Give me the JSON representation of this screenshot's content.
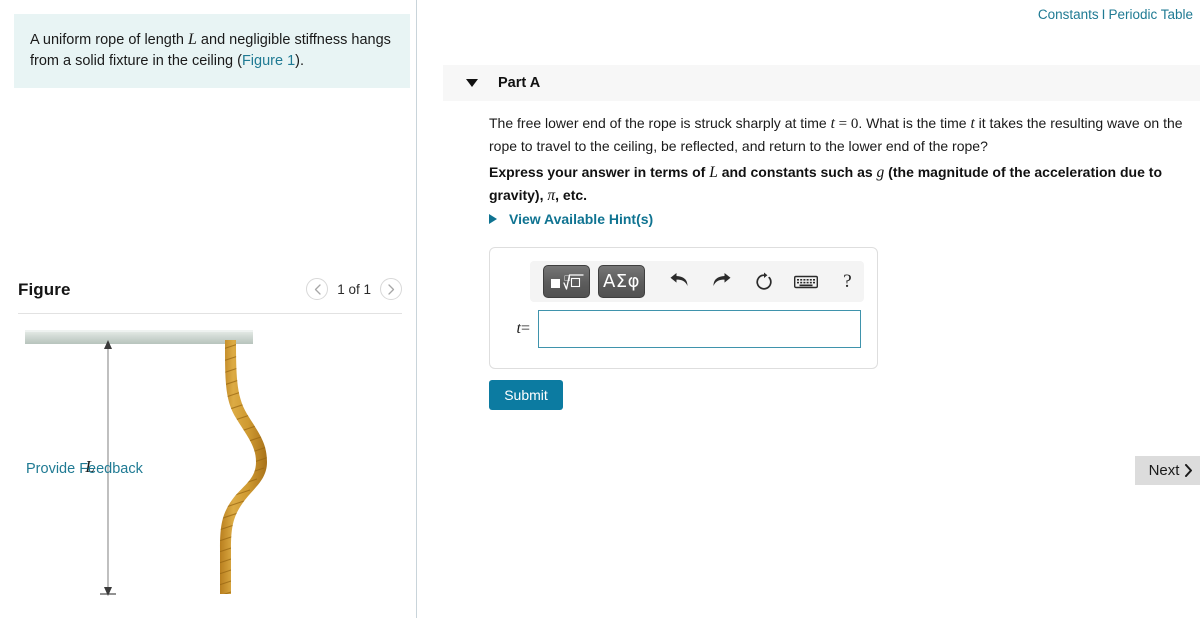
{
  "top_links": {
    "constants": "Constants",
    "separator": "I",
    "periodic_table": "Periodic Table"
  },
  "problem": {
    "text_part1": "A uniform rope of length ",
    "var_L": "L",
    "text_part2": " and negligible stiffness hangs from a solid fixture in the ceiling (",
    "figure_link": "Figure 1",
    "text_part3": ")."
  },
  "figure_panel": {
    "title": "Figure",
    "prev_icon": "chevron-left",
    "next_icon": "chevron-right",
    "counter": "1 of 1",
    "length_label": "L"
  },
  "part": {
    "caret_icon": "caret-down",
    "label": "Part A",
    "question_a": "The free lower end of the rope is struck sharply at time ",
    "question_var_t1": "t",
    "question_eq": " = ",
    "question_zero": "0",
    "question_b": ". What is the time ",
    "question_var_t2": "t",
    "question_c": " it takes the resulting wave on the rope to travel to the ceiling, be reflected, and return to the lower end of the rope?",
    "express_a": "Express your answer in terms of ",
    "express_var_L": "L",
    "express_b": " and constants such as ",
    "express_var_g": "g",
    "express_c": " (the magnitude of the acceleration due to gravity), ",
    "express_pi": "π",
    "express_d": ", etc.",
    "hints_label": "View Available Hint(s)",
    "hints_caret_icon": "caret-right"
  },
  "answer": {
    "toolbar": [
      {
        "name": "math-template-button",
        "label": "□ⁿ√□",
        "type": "math-root"
      },
      {
        "name": "greek-letters-button",
        "label": "ΑΣφ",
        "type": "greek"
      },
      {
        "name": "undo-icon",
        "label": "undo",
        "type": "icon"
      },
      {
        "name": "redo-icon",
        "label": "redo",
        "type": "icon"
      },
      {
        "name": "reset-icon",
        "label": "reset",
        "type": "icon"
      },
      {
        "name": "keyboard-icon",
        "label": "keyboard",
        "type": "icon"
      },
      {
        "name": "help-icon",
        "label": "?",
        "type": "icon"
      }
    ],
    "variable_label": "t",
    "equals": "=",
    "input_value": "",
    "input_placeholder": ""
  },
  "actions": {
    "submit_label": "Submit",
    "feedback_label": "Provide Feedback",
    "next_label": "Next",
    "next_icon": "chevron-right"
  },
  "colors": {
    "accent_teal": "#1f7a93",
    "submit_blue": "#0c7ba1",
    "statement_bg": "#e8f4f4",
    "rope_gold": "#c8912b",
    "ceiling_gray": "#c5cfc9"
  }
}
